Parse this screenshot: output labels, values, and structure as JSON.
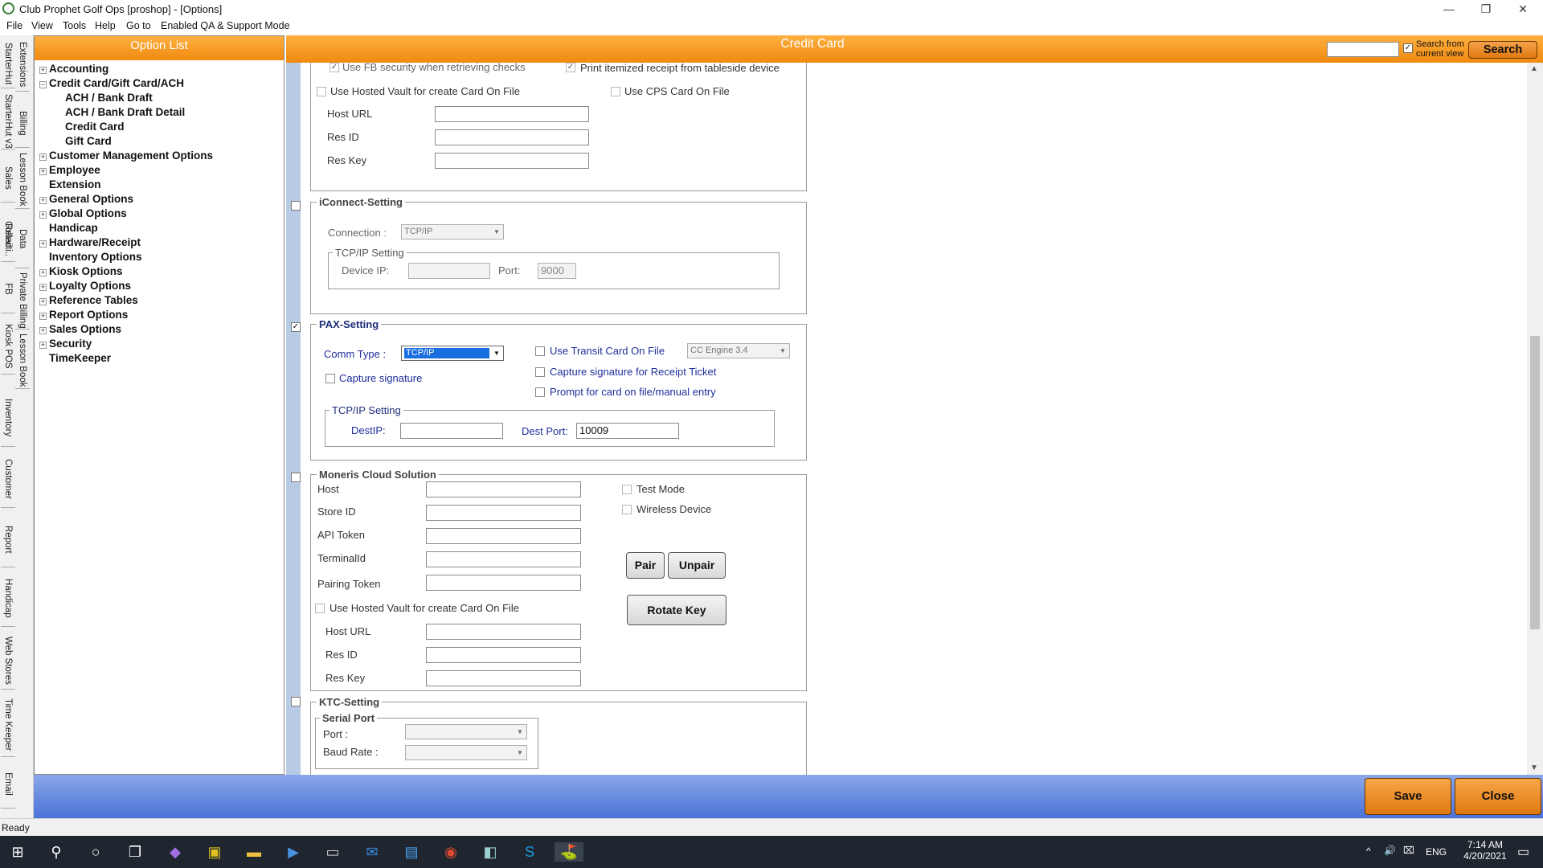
{
  "window": {
    "title": "Club Prophet Golf Ops [proshop] - [Options]",
    "minimize": "—",
    "restore": "❐",
    "close": "✕"
  },
  "menu": [
    "File",
    "View",
    "Tools",
    "Help",
    "Go to",
    "Enabled QA & Support Mode"
  ],
  "vtabs": [
    "StarterHut",
    "Extensions",
    "StarterHut v3",
    "Billing",
    "Sales",
    "Lesson Book",
    "Retail",
    "Data Collecti..",
    "FB",
    "Private Billing",
    "Kiosk POS",
    "Lesson Book",
    "Inventory",
    "Customer",
    "Report",
    "Handicap",
    "Web Stores",
    "Time Keeper",
    "Email"
  ],
  "option_list": {
    "title": "Option List",
    "items": [
      {
        "label": "Accounting",
        "expander": "+"
      },
      {
        "label": "Credit Card/Gift Card/ACH",
        "expander": "−"
      },
      {
        "label": "ACH / Bank Draft",
        "expander": ""
      },
      {
        "label": "ACH / Bank Draft Detail",
        "expander": ""
      },
      {
        "label": "Credit Card",
        "expander": ""
      },
      {
        "label": "Gift Card",
        "expander": ""
      },
      {
        "label": "Customer Management Options",
        "expander": "+"
      },
      {
        "label": "Employee",
        "expander": "+"
      },
      {
        "label": "Extension",
        "expander": ""
      },
      {
        "label": "General Options",
        "expander": "+"
      },
      {
        "label": "Global Options",
        "expander": "+"
      },
      {
        "label": "Handicap",
        "expander": ""
      },
      {
        "label": "Hardware/Receipt",
        "expander": "+"
      },
      {
        "label": "Inventory Options",
        "expander": ""
      },
      {
        "label": "Kiosk Options",
        "expander": "+"
      },
      {
        "label": "Loyalty Options",
        "expander": "+"
      },
      {
        "label": "Reference Tables",
        "expander": "+"
      },
      {
        "label": "Report Options",
        "expander": "+"
      },
      {
        "label": "Sales Options",
        "expander": "+"
      },
      {
        "label": "Security",
        "expander": "+"
      },
      {
        "label": "TimeKeeper",
        "expander": ""
      }
    ]
  },
  "main": {
    "title": "Credit Card",
    "search": {
      "value": "",
      "checked": "✓",
      "label_line1": "Search from",
      "label_line2": "current view",
      "button": "Search"
    }
  },
  "top_section": {
    "fb_security": {
      "label": "Use FB security when retrieving checks",
      "checked": "✓"
    },
    "itemized_receipt": {
      "label": "Print itemized receipt from tableside device",
      "checked": "✓"
    },
    "hosted_vault": "Use Hosted Vault for create Card On File",
    "cps_card": "Use CPS Card On File",
    "host_url": "Host URL",
    "res_id": "Res ID",
    "res_key": "Res Key"
  },
  "iconnect": {
    "title": "iConnect-Setting",
    "connection_label": "Connection :",
    "connection_value": "TCP/IP",
    "tcpip_title": "TCP/IP Setting",
    "device_ip_label": "Device IP:",
    "device_ip": "",
    "port_label": "Port:",
    "port": "9000"
  },
  "pax": {
    "enabled": "✓",
    "title": "PAX-Setting",
    "comm_type_label": "Comm Type :",
    "comm_type": "TCP/IP",
    "transit_label": "Use Transit Card On File",
    "cc_engine": "CC Engine 3.4",
    "capture_sig": "Capture signature",
    "capture_sig_receipt": "Capture signature for Receipt Ticket",
    "prompt_card": "Prompt for card on file/manual entry",
    "tcpip_title": "TCP/IP Setting",
    "dest_ip_label": "DestIP:",
    "dest_ip": "",
    "dest_port_label": "Dest Port:",
    "dest_port": "10009"
  },
  "moneris": {
    "title": "Moneris Cloud Solution",
    "host": "Host",
    "store_id": "Store ID",
    "api_token": "API Token",
    "terminal_id": "TerminalId",
    "pairing_token": "Pairing Token",
    "test_mode": "Test Mode",
    "wireless_device": "Wireless Device",
    "pair": "Pair",
    "unpair": "Unpair",
    "rotate_key": "Rotate Key",
    "hosted_vault": "Use Hosted Vault for create Card On File",
    "host_url": "Host URL",
    "res_id": "Res ID",
    "res_key": "Res Key"
  },
  "ktc": {
    "title": "KTC-Setting",
    "serial_port": "Serial Port",
    "port_label": "Port :",
    "baud_label": "Baud Rate :"
  },
  "footer": {
    "save": "Save",
    "close": "Close"
  },
  "status": "Ready",
  "taskbar": {
    "time": "7:14 AM",
    "date": "4/20/2021",
    "lang": "ENG"
  }
}
